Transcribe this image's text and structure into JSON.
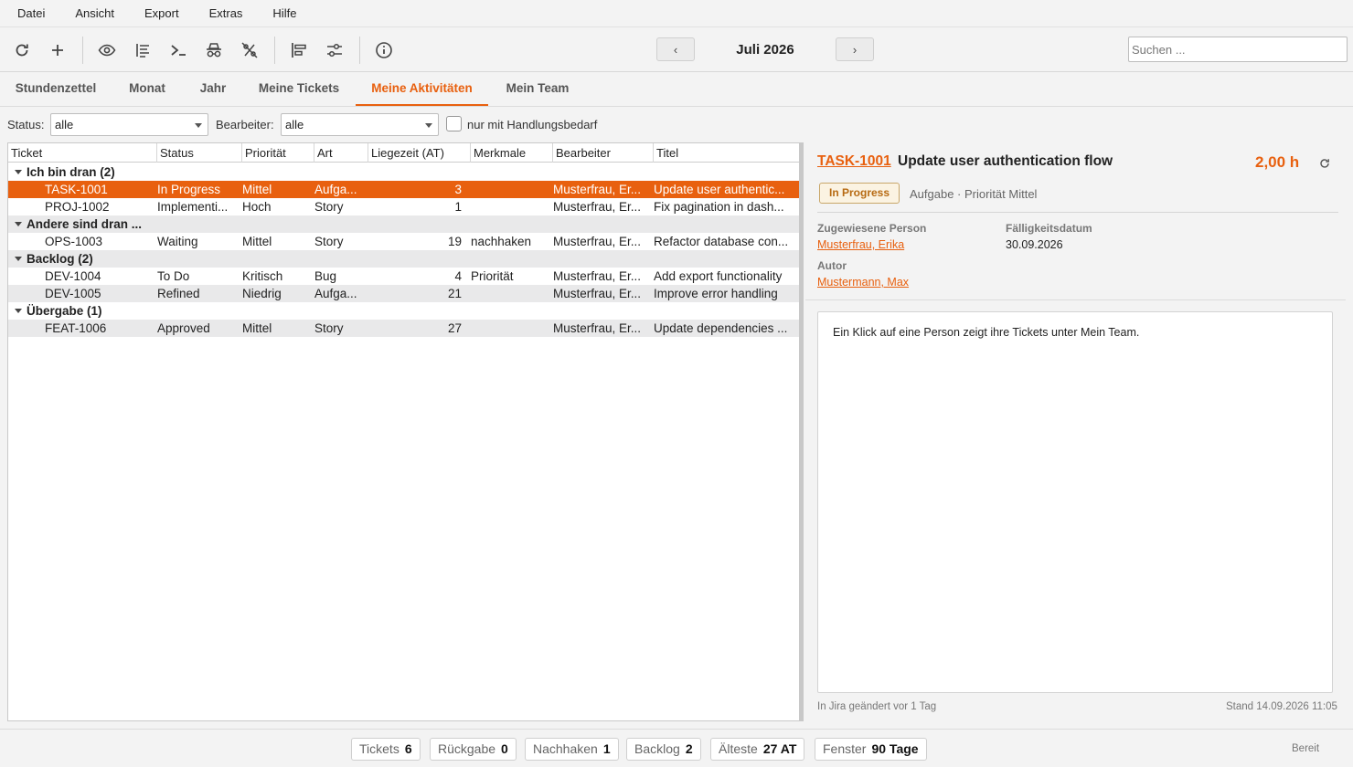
{
  "menu": [
    "Datei",
    "Ansicht",
    "Export",
    "Extras",
    "Hilfe"
  ],
  "toolbar": {
    "buttons": [
      "refresh-icon",
      "add-icon",
      "eye-icon",
      "list-icon",
      "terminal-icon",
      "incognito-icon",
      "percent-off-icon",
      "align-left-icon",
      "sliders-icon",
      "info-icon"
    ],
    "prev": "‹",
    "next": "›",
    "month": "Juli 2026",
    "search_placeholder": "Suchen ..."
  },
  "tabs": [
    "Stundenzettel",
    "Monat",
    "Jahr",
    "Meine Tickets",
    "Meine Aktivitäten",
    "Mein Team"
  ],
  "active_tab": "Meine Aktivitäten",
  "filters": {
    "status_label": "Status:",
    "status_value": "alle",
    "assignee_label": "Bearbeiter:",
    "assignee_value": "alle",
    "action_label": "nur mit Handlungsbedarf"
  },
  "table": {
    "columns": [
      "Ticket",
      "Status",
      "Priorität",
      "Art",
      "Liegezeit (AT)",
      "Merkmale",
      "Bearbeiter",
      "Titel"
    ],
    "groups": [
      {
        "label": "Ich bin dran  (2)"
      },
      {
        "label": "Andere sind dran ..."
      },
      {
        "label": "Backlog  (2)"
      },
      {
        "label": "Übergabe  (1)"
      }
    ],
    "rows": [
      {
        "ticket": "TASK-1001",
        "status": "In Progress",
        "priority": "Mittel",
        "type": "Aufga...",
        "age": "3",
        "tags": "",
        "assignee": "Musterfrau, Er...",
        "title": "Update user authentic..."
      },
      {
        "ticket": "PROJ-1002",
        "status": "Implementi...",
        "priority": "Hoch",
        "type": "Story",
        "age": "1",
        "tags": "",
        "assignee": "Musterfrau, Er...",
        "title": "Fix pagination in dash..."
      },
      {
        "ticket": "OPS-1003",
        "status": "Waiting",
        "priority": "Mittel",
        "type": "Story",
        "age": "19",
        "tags": "nachhaken",
        "assignee": "Musterfrau, Er...",
        "title": "Refactor database con..."
      },
      {
        "ticket": "DEV-1004",
        "status": "To Do",
        "priority": "Kritisch",
        "type": "Bug",
        "age": "4",
        "tags": "Priorität",
        "assignee": "Musterfrau, Er...",
        "title": "Add export functionality"
      },
      {
        "ticket": "DEV-1005",
        "status": "Refined",
        "priority": "Niedrig",
        "type": "Aufga...",
        "age": "21",
        "tags": "",
        "assignee": "Musterfrau, Er...",
        "title": "Improve error handling"
      },
      {
        "ticket": "FEAT-1006",
        "status": "Approved",
        "priority": "Mittel",
        "type": "Story",
        "age": "27",
        "tags": "",
        "assignee": "Musterfrau, Er...",
        "title": "Update dependencies ..."
      }
    ]
  },
  "detail": {
    "key": "TASK-1001",
    "title": "Update user authentication flow",
    "hours": "2,00 h",
    "status_badge": "In Progress",
    "meta": "Aufgabe · Priorität Mittel",
    "assignee_label": "Zugewiesene Person",
    "assignee": "Musterfrau, Erika",
    "due_label": "Fälligkeitsdatum",
    "due": "30.09.2026",
    "author_label": "Autor",
    "author": "Mustermann, Max",
    "note": "Ein Klick auf eine Person zeigt ihre Tickets unter Mein Team.",
    "footer_left": "In Jira geändert vor 1 Tag",
    "footer_right": "Stand 14.09.2026 11:05"
  },
  "status": {
    "chips": [
      {
        "label": "Tickets",
        "value": "6"
      },
      {
        "label": "Rückgabe",
        "value": "0"
      },
      {
        "label": "Nachhaken",
        "value": "1"
      },
      {
        "label": "Backlog",
        "value": "2"
      },
      {
        "label": "Älteste",
        "value": "27 AT"
      },
      {
        "label": "Fenster",
        "value": "90 Tage"
      }
    ],
    "ready": "Bereit"
  },
  "colors": {
    "accent": "#e8600f",
    "selected_row": "#e8600f",
    "alt_row": "#e9e9ea"
  }
}
